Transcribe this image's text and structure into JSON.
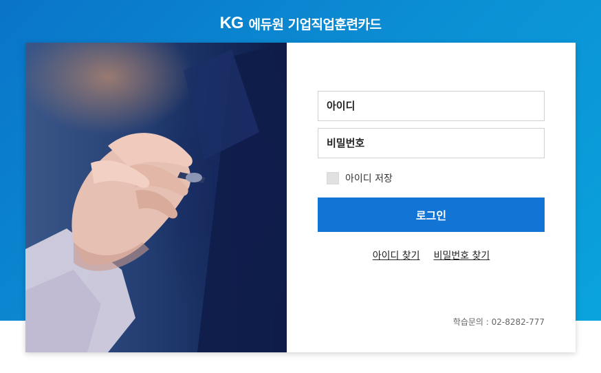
{
  "header": {
    "logo": "KG",
    "title": "에듀원 기업직업훈련카드"
  },
  "hero": {
    "image": "business-hand-with-pen-photo"
  },
  "login": {
    "id_placeholder": "아이디",
    "password_placeholder": "비밀번호",
    "remember_label": "아이디 저장",
    "remember_checked": false,
    "login_button": "로그인",
    "find_id": "아이디 찾기",
    "find_password": "비밀번호 찾기",
    "contact": "학습문의 : 02-8282-777"
  },
  "colors": {
    "brand_band": "#0b87d0",
    "primary_button": "#1274d4"
  }
}
